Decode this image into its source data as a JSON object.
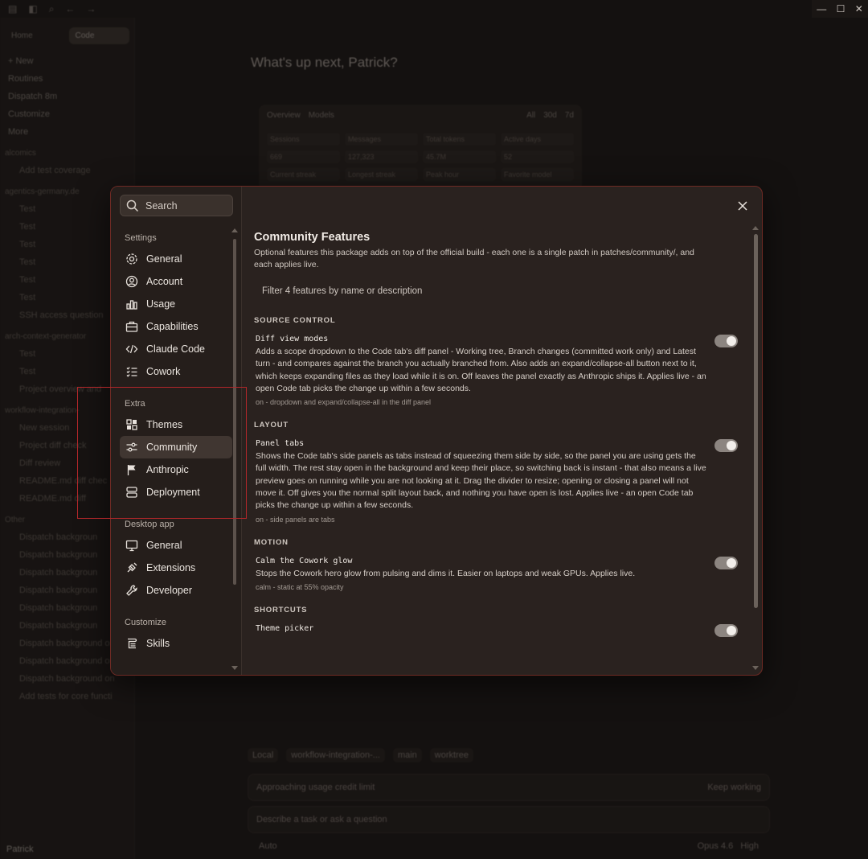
{
  "background": {
    "tabs": [
      "Home",
      "Code"
    ],
    "nav": [
      "New",
      "Routines",
      "Dispatch",
      "Customize",
      "More"
    ],
    "dispatch_badge": "8m",
    "groups": [
      {
        "name": "alcomics",
        "items": [
          "Add test coverage"
        ]
      },
      {
        "name": "agentics-germany.de",
        "items": [
          "Test",
          "Test",
          "Test",
          "Test",
          "Test",
          "Test",
          "SSH access question"
        ]
      },
      {
        "name": "arch-context-generator",
        "items": [
          "Test",
          "Test",
          "Project overview and"
        ]
      },
      {
        "name": "workflow-integration-",
        "items": [
          "New session",
          "Project diff check",
          "Diff review",
          "README.md diff chec",
          "README.md diff"
        ]
      },
      {
        "name": "Other",
        "items": [
          "Dispatch backgroun",
          "Dispatch backgroun",
          "Dispatch backgroun",
          "Dispatch backgroun",
          "Dispatch backgroun",
          "Dispatch backgroun",
          "Dispatch background on",
          "Dispatch background on",
          "Dispatch background on",
          "Add tests for core functi"
        ]
      }
    ],
    "user": "Patrick",
    "greeting": "What's up next, Patrick?",
    "stats_tabs": [
      "Overview",
      "Models"
    ],
    "stats_ranges": [
      "All",
      "30d",
      "7d"
    ],
    "stats": [
      "Sessions",
      "Messages",
      "Total tokens",
      "Active days",
      "669",
      "127,323",
      "45.7M",
      "52",
      "Current streak",
      "Longest streak",
      "Peak hour",
      "Favorite model"
    ],
    "chips": [
      "Local",
      "workflow-integration-...",
      "main",
      "worktree"
    ],
    "usage_notice": "Approaching usage credit limit",
    "keep_working": "Keep working",
    "prompt_placeholder": "Describe a task or ask a question",
    "footer_left": "Auto",
    "footer_model": "Opus 4.6",
    "footer_effort": "High"
  },
  "modal": {
    "search_placeholder": "Search",
    "nav": [
      {
        "group": "Settings",
        "items": [
          "General",
          "Account",
          "Usage",
          "Capabilities",
          "Claude Code",
          "Cowork"
        ]
      },
      {
        "group": "Extra",
        "items": [
          "Themes",
          "Community",
          "Anthropic",
          "Deployment"
        ]
      },
      {
        "group": "Desktop app",
        "items": [
          "General",
          "Extensions",
          "Developer"
        ]
      },
      {
        "group": "Customize",
        "items": [
          "Skills"
        ]
      }
    ],
    "active_item": "Community",
    "title": "Community Features",
    "description": "Optional features this package adds on top of the official build - each one is a single patch in patches/community/, and each applies live.",
    "filter_placeholder": "Filter 4 features by name or description",
    "sections": [
      {
        "label": "SOURCE CONTROL",
        "name": "Diff view modes",
        "desc": "Adds a scope dropdown to the Code tab's diff panel - Working tree, Branch changes (committed work only) and Latest turn - and compares against the branch you actually branched from. Also adds an expand/collapse-all button next to it, which keeps expanding files as they load while it is on. Off leaves the panel exactly as Anthropic ships it. Applies live - an open Code tab picks the change up within a few seconds.",
        "status": "on - dropdown and expand/collapse-all in the diff panel",
        "enabled": true
      },
      {
        "label": "LAYOUT",
        "name": "Panel tabs",
        "desc": "Shows the Code tab's side panels as tabs instead of squeezing them side by side, so the panel you are using gets the full width. The rest stay open in the background and keep their place, so switching back is instant - that also means a live preview goes on running while you are not looking at it. Drag the divider to resize; opening or closing a panel will not move it. Off gives you the normal split layout back, and nothing you have open is lost. Applies live - an open Code tab picks the change up within a few seconds.",
        "status": "on - side panels are tabs",
        "enabled": true
      },
      {
        "label": "MOTION",
        "name": "Calm the Cowork glow",
        "desc": "Stops the Cowork hero glow from pulsing and dims it. Easier on laptops and weak GPUs. Applies live.",
        "status": "calm - static at 55% opacity",
        "enabled": true
      },
      {
        "label": "SHORTCUTS",
        "name": "Theme picker",
        "desc": "",
        "status": "",
        "enabled": true
      }
    ]
  },
  "colors": {
    "modal_border": "#6e2a24",
    "highlight": "#b3272a",
    "toggle_on": "#8c8580"
  }
}
